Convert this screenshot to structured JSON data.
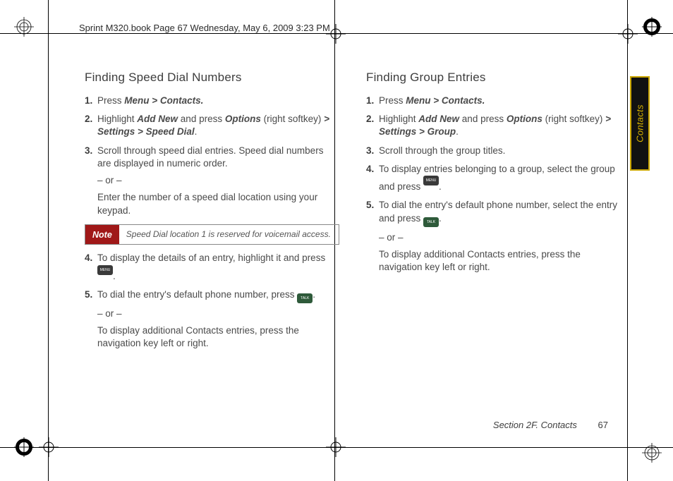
{
  "header": "Sprint M320.book  Page 67  Wednesday, May 6, 2009  3:23 PM",
  "sideTab": "Contacts",
  "footer": {
    "section": "Section 2F. Contacts",
    "page": "67"
  },
  "left": {
    "heading": "Finding Speed Dial Numbers",
    "i1a": "Press ",
    "i1b": "Menu > Contacts.",
    "i2a": "Highlight ",
    "i2b": "Add New",
    "i2c": " and press ",
    "i2d": "Options",
    "i2e": " (right softkey) ",
    "i2f": "> Settings > Speed Dial",
    "i2g": ".",
    "i3": "Scroll through speed dial entries. Speed dial numbers are displayed in numeric order.",
    "or": "– or –",
    "i3b": "Enter the number of a speed dial location using your keypad.",
    "noteLabel": "Note",
    "noteText": "Speed Dial location 1 is reserved for voicemail access.",
    "i4a": "To display the details of an entry, highlight it and press ",
    "i4b": ".",
    "i5a": "To dial the entry's default phone number, press ",
    "i5b": ".",
    "i5c": "To display additional Contacts entries, press the navigation key left or right."
  },
  "right": {
    "heading": "Finding Group Entries",
    "i1a": "Press ",
    "i1b": "Menu > Contacts.",
    "i2a": "Highlight ",
    "i2b": "Add New",
    "i2c": " and press ",
    "i2d": "Options",
    "i2e": " (right softkey) ",
    "i2f": "> Settings > Group",
    "i2g": ".",
    "i3": "Scroll through the group titles.",
    "i4a": "To display entries belonging to a group, select the group and press ",
    "i4b": ".",
    "i5a": "To dial the entry's default phone number, select the entry and press ",
    "i5b": ".",
    "or": "– or –",
    "i5c": "To display additional Contacts entries, press the navigation key left or right."
  },
  "keys": {
    "menu": "MENU OK",
    "talk": "TALK"
  }
}
